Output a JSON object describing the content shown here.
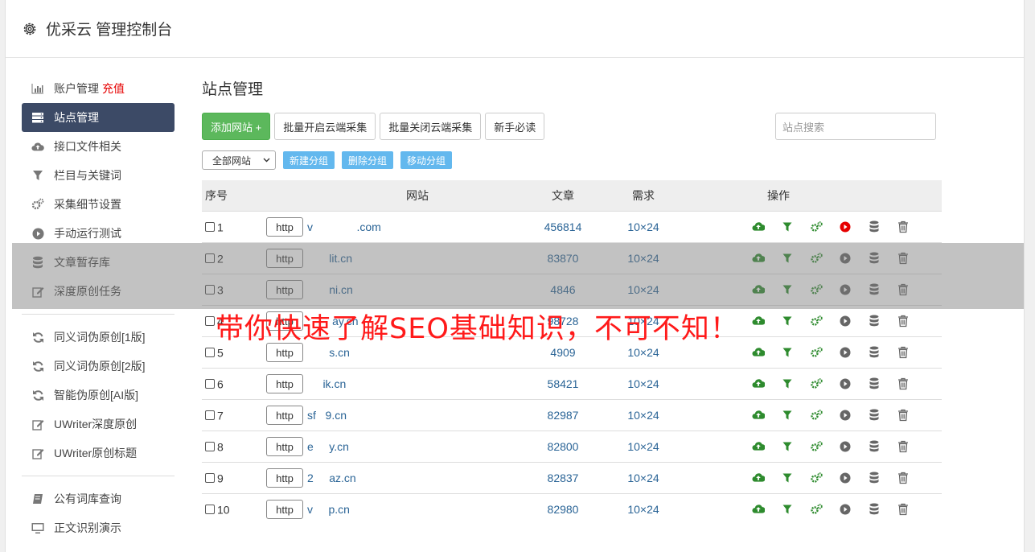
{
  "app": {
    "title": "优采云 管理控制台"
  },
  "sidebar": {
    "items": [
      {
        "label": "账户管理",
        "extra": "充值",
        "icon": "bar-chart-icon"
      },
      {
        "label": "站点管理",
        "icon": "server-icon",
        "active": true
      },
      {
        "label": "接口文件相关",
        "icon": "cloud-upload-icon"
      },
      {
        "label": "栏目与关键词",
        "icon": "filter-icon"
      },
      {
        "label": "采集细节设置",
        "icon": "gears-icon"
      },
      {
        "label": "手动运行测试",
        "icon": "play-circle-icon"
      },
      {
        "label": "文章暂存库",
        "icon": "database-icon"
      },
      {
        "label": "深度原创任务",
        "icon": "edit-icon"
      }
    ],
    "group2": [
      {
        "label": "同义词伪原创[1版]",
        "icon": "refresh-icon"
      },
      {
        "label": "同义词伪原创[2版]",
        "icon": "refresh-icon"
      },
      {
        "label": "智能伪原创[AI版]",
        "icon": "refresh-icon"
      },
      {
        "label": "UWriter深度原创",
        "icon": "edit-icon"
      },
      {
        "label": "UWriter原创标题",
        "icon": "edit-icon"
      }
    ],
    "group3": [
      {
        "label": "公有词库查询",
        "icon": "book-icon"
      },
      {
        "label": "正文识别演示",
        "icon": "monitor-icon"
      }
    ]
  },
  "main": {
    "title": "站点管理",
    "buttons": {
      "add": "添加网站 +",
      "batch_open": "批量开启云端采集",
      "batch_close": "批量关闭云端采集",
      "guide": "新手必读"
    },
    "search_placeholder": "站点搜索",
    "group_select": "全部网站",
    "group_buttons": {
      "new": "新建分组",
      "delete": "删除分组",
      "move": "移动分组"
    },
    "columns": {
      "no": "序号",
      "site": "网站",
      "articles": "文章",
      "demand": "需求",
      "ops": "操作"
    },
    "rows": [
      {
        "no": "1",
        "protocol": "http",
        "domain": "v              .com",
        "articles": "456814",
        "demand": "10×24",
        "play_active": true
      },
      {
        "no": "2",
        "protocol": "http",
        "domain": "       lit.cn",
        "articles": "83870",
        "demand": "10×24",
        "play_active": false
      },
      {
        "no": "3",
        "protocol": "http",
        "domain": "       ni.cn",
        "articles": "4846",
        "demand": "10×24",
        "play_active": false
      },
      {
        "no": "4",
        "protocol": "http",
        "domain": "        ay.cn",
        "articles": "98728",
        "demand": "10×24",
        "play_active": false
      },
      {
        "no": "5",
        "protocol": "http",
        "domain": "       s.cn",
        "articles": "4909",
        "demand": "10×24",
        "play_active": false
      },
      {
        "no": "6",
        "protocol": "http",
        "domain": "     ik.cn",
        "articles": "58421",
        "demand": "10×24",
        "play_active": false
      },
      {
        "no": "7",
        "protocol": "http",
        "domain": "sf   9.cn",
        "articles": "82987",
        "demand": "10×24",
        "play_active": false
      },
      {
        "no": "8",
        "protocol": "http",
        "domain": "e     y.cn",
        "articles": "82800",
        "demand": "10×24",
        "play_active": false
      },
      {
        "no": "9",
        "protocol": "http",
        "domain": "2     az.cn",
        "articles": "82837",
        "demand": "10×24",
        "play_active": false
      },
      {
        "no": "10",
        "protocol": "http",
        "domain": "v     p.cn",
        "articles": "82980",
        "demand": "10×24",
        "play_active": false
      }
    ]
  },
  "banner": "带你快速了解SEO基础知识，不可不知！",
  "colors": {
    "active_nav": "#3c4a66",
    "green": "#5cb85c",
    "link": "#2a6496",
    "red": "#e60000",
    "icon_green": "#2e8b2e"
  }
}
